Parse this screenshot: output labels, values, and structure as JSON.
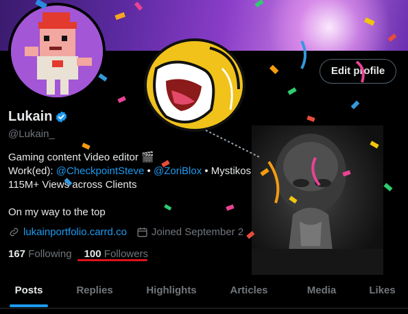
{
  "profile": {
    "display_name": "Lukain",
    "handle": "@Lukain_",
    "edit_button_label": "Edit profile"
  },
  "bio": {
    "line1": "Gaming content Video editor 🎬",
    "line2_prefix": "Work(ed): ",
    "line2_link1": "@CheckpointSteve",
    "line2_sep": " • ",
    "line2_link2": "@ZoriBlox",
    "line2_suffix": " • Mystikos",
    "line3": "115M+ Views across Clients",
    "line4": "On my way to the top"
  },
  "meta": {
    "website": "lukainportfolio.carrd.co",
    "joined": "Joined September 2"
  },
  "stats": {
    "following_count": "167",
    "following_label": "Following",
    "followers_count": "100",
    "followers_label": "Followers"
  },
  "tabs": [
    {
      "label": "Posts",
      "active": true
    },
    {
      "label": "Replies",
      "active": false
    },
    {
      "label": "Highlights",
      "active": false
    },
    {
      "label": "Articles",
      "active": false
    },
    {
      "label": "Media",
      "active": false
    },
    {
      "label": "Likes",
      "active": false
    }
  ],
  "colors": {
    "accent": "#1d9bf0",
    "underline_annotation": "#e0121c",
    "muted": "#71767b"
  }
}
